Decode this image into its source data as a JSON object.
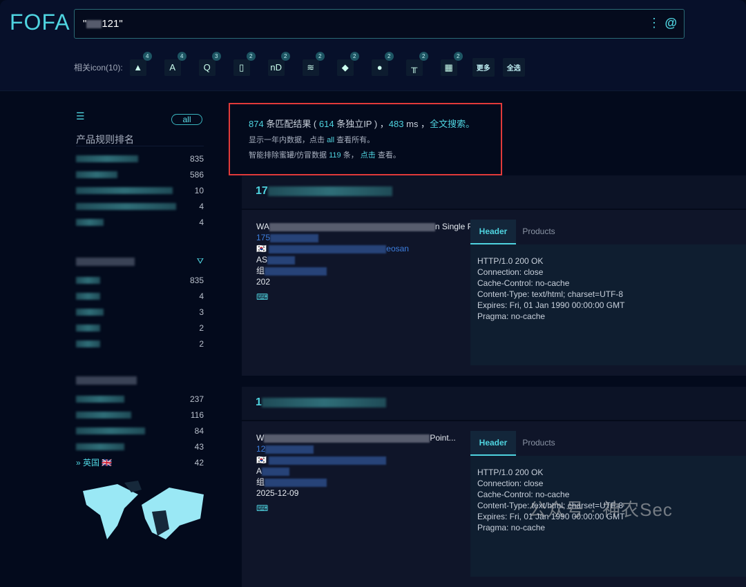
{
  "header": {
    "logo": "FOFA",
    "query_prefix": "\"",
    "query_suffix": "121\"",
    "more_icon": "more-vertical-icon",
    "search_icon": "at-search-icon"
  },
  "icons": {
    "label": "相关icon(10):",
    "items": [
      {
        "glyph": "▲",
        "count": "4"
      },
      {
        "glyph": "A",
        "count": "4"
      },
      {
        "glyph": "Q",
        "count": "3"
      },
      {
        "glyph": "▯",
        "count": "2"
      },
      {
        "glyph": "nD",
        "count": "2"
      },
      {
        "glyph": "≋",
        "count": "2"
      },
      {
        "glyph": "◆",
        "count": "2"
      },
      {
        "glyph": "●",
        "count": "2"
      },
      {
        "glyph": "╥",
        "count": "2"
      },
      {
        "glyph": "▦",
        "count": "2"
      }
    ],
    "more": "更多",
    "select_all": "全选"
  },
  "sidebar": {
    "all": "all",
    "rank_title": "产品规则排名",
    "rank_counts": [
      "835",
      "586",
      "10",
      "4",
      "4"
    ],
    "group2_counts": [
      "835",
      "4",
      "3",
      "2",
      "2"
    ],
    "country_counts": [
      "237",
      "116",
      "84",
      "43",
      "42"
    ],
    "last_country": "英国"
  },
  "summary": {
    "total": "874",
    "t1": " 条匹配结果 ( ",
    "ips": "614",
    "t2": " 条独立IP ) ，",
    "ms": "483",
    "t3": " ms ，",
    "fulltext": "全文搜索。",
    "line2a": "显示一年内数据，点击 ",
    "all": "all",
    "line2b": " 查看所有。",
    "line3a": "智能排除蜜罐/仿冒数据 ",
    "excluded": "119",
    "line3b": " 条，",
    "click": "点击",
    "line3c": " 查看。"
  },
  "results": [
    {
      "ip_prefix": "17",
      "title_prefix": "WA",
      "title_suffix": "n Single Point...",
      "ip2_prefix": "175",
      "loc_suffix": "eosan",
      "as_prefix": "AS",
      "org_prefix": "组",
      "date_prefix": "202",
      "tabs": [
        "Header",
        "Products"
      ],
      "headers": [
        "HTTP/1.0 200 OK",
        "Connection: close",
        "Cache-Control: no-cache",
        "Content-Type: text/html; charset=UTF-8",
        "Expires: Fri, 01 Jan 1990 00:00:00 GMT",
        "Pragma: no-cache"
      ]
    },
    {
      "ip_prefix": "1",
      "title_prefix": "W",
      "title_suffix": "Point...",
      "ip2_prefix": "12",
      "loc_suffix": "",
      "as_prefix": "A",
      "org_prefix": "组",
      "date_prefix": "2025-12-09",
      "tabs": [
        "Header",
        "Products"
      ],
      "headers": [
        "HTTP/1.0 200 OK",
        "Connection: close",
        "Cache-Control: no-cache",
        "Content-Type: text/html; charset=UTF-8",
        "Expires: Fri, 01 Jan 1990 00:00:00 GMT",
        "Pragma: no-cache"
      ]
    }
  ],
  "watermark": "公众号 · 神农Sec",
  "colors": {
    "accent": "#4fd4e0",
    "highlight_box": "#e23a3a",
    "link": "#3d7fe0"
  }
}
